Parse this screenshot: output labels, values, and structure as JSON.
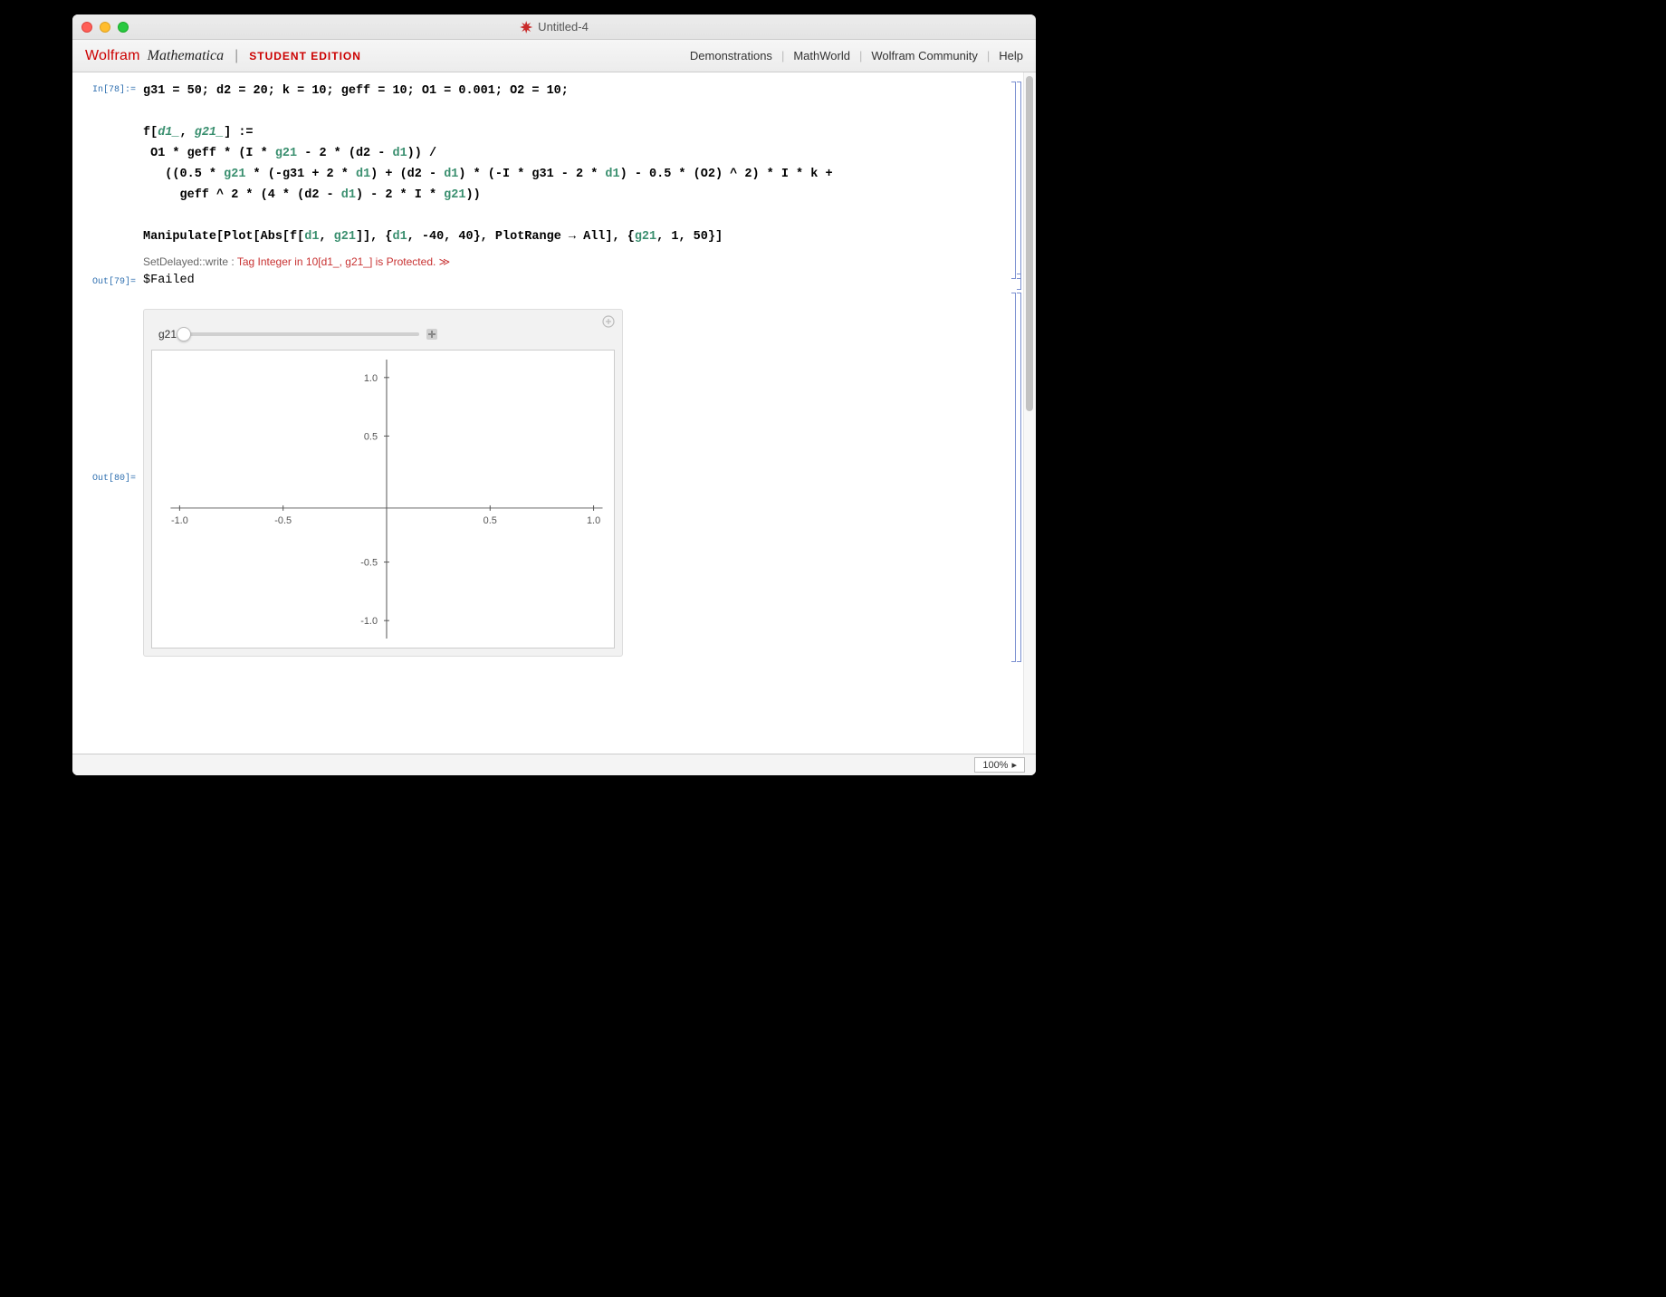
{
  "window": {
    "title": "Untitled-4"
  },
  "brand": {
    "wolfram": "Wolfram",
    "mathematica": "Mathematica",
    "student": "STUDENT EDITION"
  },
  "toolbar_links": {
    "demonstrations": "Demonstrations",
    "mathworld": "MathWorld",
    "community": "Wolfram Community",
    "help": "Help"
  },
  "labels": {
    "in78": "In[78]:=",
    "out79": "Out[79]=",
    "out80": "Out[80]="
  },
  "code": {
    "line1a": "g31 = 50; d2 = 20; k = 10; geff = 10; O1 = 0.001; O2 = 10;",
    "line2a": "f[",
    "line2_p1": "d1_",
    "line2b": ", ",
    "line2_p2": "g21_",
    "line2c": "] :=",
    "line3a": " O1 * geff * (I * ",
    "line3_s1": "g21",
    "line3b": " - 2 * (d2 - ",
    "line3_s2": "d1",
    "line3c": ")) /",
    "line4a": "   ((0.5 * ",
    "line4_s1": "g21",
    "line4b": " * (-g31 + 2 * ",
    "line4_s2": "d1",
    "line4c": ") + (d2 - ",
    "line4_s3": "d1",
    "line4d": ") * (-I * g31 - 2 * ",
    "line4_s4": "d1",
    "line4e": ") - 0.5 * (O2) ^ 2) * I * k +",
    "line5a": "     geff ^ 2 * (4 * (d2 - ",
    "line5_s1": "d1",
    "line5b": ") - 2 * I * ",
    "line5_s2": "g21",
    "line5c": "))",
    "line6a": "Manipulate[Plot[Abs[f[",
    "line6_s1": "d1",
    "line6b": ", ",
    "line6_s2": "g21",
    "line6c": "]], {",
    "line6_s3": "d1",
    "line6d": ", -40, 40}, PlotRange → All], {",
    "line6_s4": "g21",
    "line6e": ", 1, 50}]"
  },
  "message": {
    "name": "SetDelayed::write",
    "colon": " : ",
    "body": "Tag Integer in 10[d1_, g21_] is Protected.",
    "chevrons": " ≫"
  },
  "output79": "$Failed",
  "manipulate": {
    "slider_label": "g21",
    "slider_min": 1,
    "slider_max": 50,
    "slider_value": 1
  },
  "chart_data": {
    "type": "line",
    "title": "",
    "xlabel": "",
    "ylabel": "",
    "x_ticks": [
      "-1.0",
      "-0.5",
      "0.5",
      "1.0"
    ],
    "y_ticks": [
      "1.0",
      "0.5",
      "-0.5",
      "-1.0"
    ],
    "xlim": [
      -1.0,
      1.0
    ],
    "ylim": [
      -1.0,
      1.0
    ],
    "series": []
  },
  "status": {
    "zoom": "100%"
  }
}
